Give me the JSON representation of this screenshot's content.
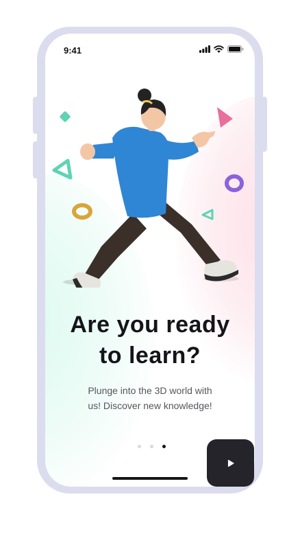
{
  "status_bar": {
    "time": "9:41"
  },
  "onboarding": {
    "headline_line1": "Are you ready",
    "headline_line2": "to learn?",
    "subtitle_line1": "Plunge into the 3D world with",
    "subtitle_line2": "us! Discover new knowledge!",
    "page_count": 3,
    "active_page": 3
  },
  "colors": {
    "frame": "#dcdcef",
    "text_dark": "#151519",
    "button_bg": "#24242a",
    "shirt_blue": "#2f86d4",
    "pants_dark": "#3b3029",
    "accent_pink": "#e8709a",
    "accent_teal": "#5fd3b3",
    "accent_purple": "#8b63d8",
    "accent_gold": "#d9a53b"
  },
  "icons": {
    "signal": "cellular-signal-icon",
    "wifi": "wifi-icon",
    "battery": "battery-icon",
    "next": "play-arrow-icon"
  }
}
